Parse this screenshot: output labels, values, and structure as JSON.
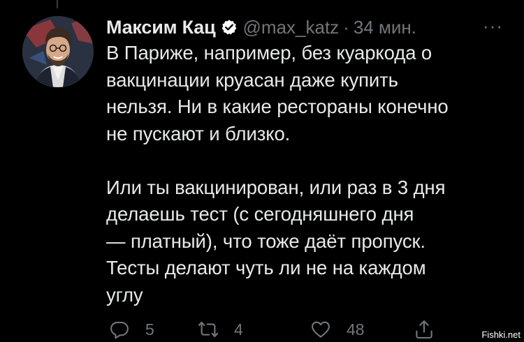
{
  "colors": {
    "background": "#000000",
    "text_primary": "#e7e9ea",
    "text_secondary": "#71767b",
    "verified": "#ffffff"
  },
  "tweet": {
    "author_name": "Максим Кац",
    "verified": true,
    "handle": "@max_katz",
    "separator": "·",
    "timestamp": "34 мин.",
    "more_label": "···",
    "paragraph_1": [
      "В Париже, например, без куаркода о",
      "вакцинации круасан даже купить",
      "нельзя. Ни в какие рестораны конечно",
      "не пускают и близко."
    ],
    "paragraph_2": [
      "Или ты вакцинирован, или раз в 3 дня",
      "делаешь тест (с сегодняшнего дня",
      "— платный), что тоже даёт пропуск.",
      "Тесты делают чуть ли не на каждом",
      "углу"
    ],
    "actions": {
      "reply": {
        "icon": "reply-icon",
        "count": "5"
      },
      "retweet": {
        "icon": "retweet-icon",
        "count": "4"
      },
      "like": {
        "icon": "heart-icon",
        "count": "48"
      },
      "share": {
        "icon": "share-icon"
      }
    }
  },
  "watermark": "Fishki.net"
}
